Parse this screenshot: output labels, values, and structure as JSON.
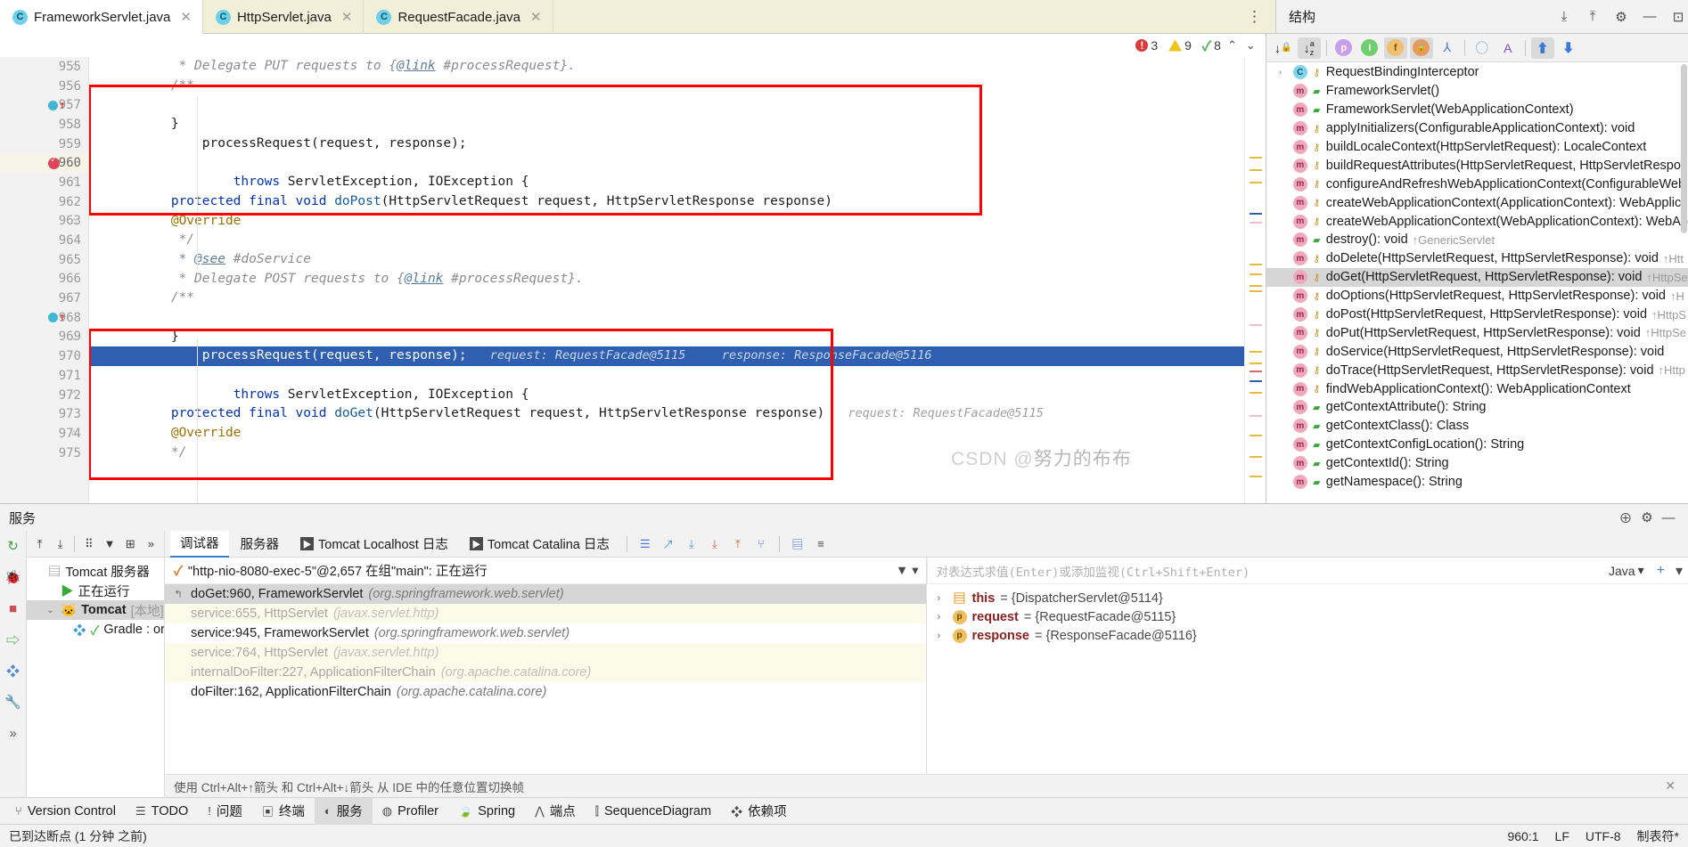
{
  "window": {
    "editor_tabs": [
      {
        "label": "FrameworkServlet.java",
        "icon": "java-class-icon",
        "active": true,
        "close": "✕"
      },
      {
        "label": "HttpServlet.java",
        "icon": "java-class-icon",
        "active": false,
        "close": "✕"
      },
      {
        "label": "RequestFacade.java",
        "icon": "java-class-icon",
        "active": false,
        "close": "✕"
      }
    ],
    "tab_overflow_menu": "⋮"
  },
  "inspections": {
    "errors": "3",
    "warnings": "9",
    "checks": "8",
    "prev": "⌃",
    "next": "⌄"
  },
  "editor": {
    "lines": [
      {
        "num": "955",
        "marker": "",
        "fold": "⌂",
        "html": "        <span class='cmt'>*/</span>"
      },
      {
        "num": "956",
        "marker": "",
        "fold": "",
        "html": "        <span class='ann'>@Override</span>"
      },
      {
        "num": "957",
        "marker": "breakpoint-arrow",
        "fold": "",
        "html": "        <span class='kw'>protected</span> <span class='kw'>final</span> <span class='kw'>void</span> <span class='mth'>doGet</span>(HttpServletRequest request, HttpServletResponse response)   <span class='hint'>request: RequestFacade@5115</span>"
      },
      {
        "num": "958",
        "marker": "",
        "fold": "⌄",
        "html": "                <span class='kw'>throws</span> ServletException, IOException {"
      },
      {
        "num": "959",
        "marker": "",
        "fold": "",
        "html": ""
      },
      {
        "num": "960",
        "marker": "breakpoint-hit",
        "fold": "",
        "highlight": true,
        "html": "            processRequest(request, response);   <span class='hint'>request: RequestFacade@5115     response: ResponseFacade@5116</span>"
      },
      {
        "num": "961",
        "marker": "",
        "fold": "⌃",
        "html": "        }"
      },
      {
        "num": "962",
        "marker": "",
        "fold": "",
        "html": ""
      },
      {
        "num": "963",
        "marker": "",
        "fold": "⌂",
        "html": "        <span class='cmt'>/**</span>"
      },
      {
        "num": "964",
        "marker": "",
        "fold": "",
        "html": "         <span class='cmt'>* Delegate POST requests to {</span><span class='lnk'>@link</span> <span class='cmt'>#processRequest}.</span>"
      },
      {
        "num": "965",
        "marker": "",
        "fold": "",
        "html": "         <span class='cmt-tag'>* </span><span class='lnk'>@see</span> <span class='cmt'>#doService</span>"
      },
      {
        "num": "966",
        "marker": "",
        "fold": "",
        "html": "         <span class='cmt'>*/</span>"
      },
      {
        "num": "967",
        "marker": "",
        "fold": "",
        "html": "        <span class='ann'>@Override</span>"
      },
      {
        "num": "968",
        "marker": "breakpoint-arrow",
        "fold": "",
        "html": "        <span class='kw'>protected</span> <span class='kw'>final</span> <span class='kw'>void</span> <span class='mth'>doPost</span>(HttpServletRequest request, HttpServletResponse response)"
      },
      {
        "num": "969",
        "marker": "",
        "fold": "⌄",
        "html": "                <span class='kw'>throws</span> ServletException, IOException {"
      },
      {
        "num": "970",
        "marker": "",
        "fold": "",
        "html": ""
      },
      {
        "num": "971",
        "marker": "",
        "fold": "",
        "html": "            processRequest(request, response);"
      },
      {
        "num": "972",
        "marker": "",
        "fold": "⌃",
        "html": "        }"
      },
      {
        "num": "973",
        "marker": "",
        "fold": "",
        "html": ""
      },
      {
        "num": "974",
        "marker": "",
        "fold": "⌂",
        "html": "        <span class='cmt'>/**</span>"
      },
      {
        "num": "975",
        "marker": "",
        "fold": "",
        "html": "         <span class='cmt'>* Delegate PUT requests to {</span><span class='lnk'>@link</span> <span class='cmt'>#processRequest}.</span>"
      }
    ],
    "annotation_boxes": [
      {
        "name": "doget-method-highlight",
        "color": "#ff0000"
      },
      {
        "name": "dopost-method-highlight",
        "color": "#ff0000"
      }
    ]
  },
  "structure": {
    "title": "结构",
    "toolbar": [
      {
        "name": "sort-by-visibility-icon",
        "glyph": "↓",
        "active": false
      },
      {
        "name": "sort-alphabetically-icon",
        "glyph": "↓",
        "active": true
      },
      {
        "name": "show-properties-icon",
        "glyph": "p",
        "color": "#c9a0e8"
      },
      {
        "name": "show-inherited-icon",
        "glyph": "I",
        "color": "#6fcf6f"
      },
      {
        "name": "show-fields-icon",
        "glyph": "f",
        "color": "#f0c070"
      },
      {
        "name": "show-non-public-icon",
        "glyph": "🔒",
        "color": "#e89a5a"
      },
      {
        "name": "group-methods-icon",
        "glyph": "Y"
      },
      {
        "name": "expand-all-icon",
        "glyph": "○"
      },
      {
        "name": "autoscroll-icon",
        "glyph": "A"
      },
      {
        "name": "collapse-all-icon",
        "glyph": "⇥"
      },
      {
        "name": "scroll-to-source-icon",
        "glyph": "⇤"
      }
    ],
    "items": [
      {
        "label": "RequestBindingInterceptor",
        "kind": "class",
        "vis": "field",
        "expand": "›",
        "clipped": true
      },
      {
        "label": "FrameworkServlet()",
        "kind": "method",
        "vis": "public"
      },
      {
        "label": "FrameworkServlet(WebApplicationContext)",
        "kind": "method",
        "vis": "public"
      },
      {
        "label": "applyInitializers(ConfigurableApplicationContext): void",
        "kind": "method",
        "vis": "protected"
      },
      {
        "label": "buildLocaleContext(HttpServletRequest): LocaleContext",
        "kind": "method",
        "vis": "protected"
      },
      {
        "label": "buildRequestAttributes(HttpServletRequest, HttpServletRespon",
        "kind": "method",
        "vis": "protected"
      },
      {
        "label": "configureAndRefreshWebApplicationContext(ConfigurableWeb",
        "kind": "method",
        "vis": "protected"
      },
      {
        "label": "createWebApplicationContext(ApplicationContext): WebApplic",
        "kind": "method",
        "vis": "protected"
      },
      {
        "label": "createWebApplicationContext(WebApplicationContext): WebAp",
        "kind": "method",
        "vis": "protected"
      },
      {
        "label": "destroy(): void",
        "sup": "↑GenericServlet",
        "kind": "method",
        "vis": "public"
      },
      {
        "label": "doDelete(HttpServletRequest, HttpServletResponse): void",
        "sup": "↑Htt",
        "kind": "method",
        "vis": "protected"
      },
      {
        "label": "doGet(HttpServletRequest, HttpServletResponse): void",
        "sup": "↑HttpSe",
        "kind": "method",
        "vis": "protected",
        "selected": true
      },
      {
        "label": "doOptions(HttpServletRequest, HttpServletResponse): void",
        "sup": "↑H",
        "kind": "method",
        "vis": "protected"
      },
      {
        "label": "doPost(HttpServletRequest, HttpServletResponse): void",
        "sup": "↑HttpS",
        "kind": "method",
        "vis": "protected"
      },
      {
        "label": "doPut(HttpServletRequest, HttpServletResponse): void",
        "sup": "↑HttpSe",
        "kind": "method",
        "vis": "protected"
      },
      {
        "label": "doService(HttpServletRequest, HttpServletResponse): void",
        "kind": "method",
        "vis": "protected"
      },
      {
        "label": "doTrace(HttpServletRequest, HttpServletResponse): void",
        "sup": "↑Http",
        "kind": "method",
        "vis": "protected"
      },
      {
        "label": "findWebApplicationContext(): WebApplicationContext",
        "kind": "method",
        "vis": "protected"
      },
      {
        "label": "getContextAttribute(): String",
        "kind": "method",
        "vis": "public"
      },
      {
        "label": "getContextClass(): Class<?>",
        "kind": "method",
        "vis": "public"
      },
      {
        "label": "getContextConfigLocation(): String",
        "kind": "method",
        "vis": "public"
      },
      {
        "label": "getContextId(): String",
        "kind": "method",
        "vis": "public"
      },
      {
        "label": "getNamespace(): String",
        "kind": "method",
        "vis": "public",
        "clipped": true
      }
    ]
  },
  "services": {
    "title": "服务",
    "header_buttons": [
      {
        "name": "services-settings-target-icon",
        "glyph": "⊕"
      },
      {
        "name": "services-gear-icon",
        "glyph": "⚙"
      },
      {
        "name": "services-minimize-icon",
        "glyph": "—"
      }
    ],
    "run_controls": [
      {
        "name": "rerun-button",
        "glyph": "↻"
      },
      {
        "name": "debug-button",
        "glyph": "🐞"
      },
      {
        "name": "stop-button",
        "glyph": "■"
      },
      {
        "name": "resume-program-button",
        "glyph": "⇥"
      },
      {
        "name": "step-over-button",
        "glyph": "◆"
      },
      {
        "name": "settings-button",
        "glyph": "🔧"
      },
      {
        "name": "more-button",
        "glyph": "»"
      }
    ],
    "tree_toolbar": [
      {
        "name": "expand-all-icon",
        "glyph": "⤒"
      },
      {
        "name": "collapse-all-icon",
        "glyph": "⤓"
      },
      {
        "name": "group-icon",
        "glyph": "⠿"
      },
      {
        "name": "filter-icon",
        "glyph": "▼"
      },
      {
        "name": "add-icon",
        "glyph": "⊞"
      },
      {
        "name": "more-icon",
        "glyph": "»"
      }
    ],
    "tree": [
      {
        "label": "Tomcat 服务器",
        "indent": 0,
        "icon": "tomcat-group-icon",
        "expand": ""
      },
      {
        "label": "正在运行",
        "indent": 1,
        "icon": "run-icon",
        "expand": ""
      },
      {
        "label": "Tomcat",
        "suffix": "[本地]",
        "indent": 1,
        "icon": "tomcat-icon",
        "expand": "⌄",
        "selected": true,
        "bold": true
      },
      {
        "label": "Gradle : org.s",
        "indent": 2,
        "icon": "gradle-icon",
        "expand": ""
      }
    ],
    "tabs": [
      {
        "label": "调试器",
        "active": true,
        "icon": ""
      },
      {
        "label": "服务器",
        "active": false,
        "icon": ""
      },
      {
        "label": "Tomcat Localhost 日志",
        "active": false,
        "icon": "console-icon"
      },
      {
        "label": "Tomcat Catalina 日志",
        "active": false,
        "icon": "console-icon"
      }
    ],
    "tab_tools": [
      {
        "name": "console-view-icon",
        "glyph": "☰"
      },
      {
        "name": "soft-wrap-icon",
        "glyph": "↵"
      },
      {
        "name": "scroll-down-icon",
        "glyph": "⤓"
      },
      {
        "name": "download-icon",
        "glyph": "⤓"
      },
      {
        "name": "upload-icon",
        "glyph": "⤒"
      },
      {
        "name": "thread-dump-icon",
        "glyph": "⑂"
      },
      {
        "name": "layout-icon",
        "glyph": "▤"
      },
      {
        "name": "settings-icon",
        "glyph": "≡"
      }
    ],
    "thread": {
      "icon": "✓",
      "label": "\"http-nio-8080-exec-5\"@2,657 在组\"main\": 正在运行"
    },
    "frames_tools": [
      {
        "name": "frames-filter-icon",
        "glyph": "▼"
      },
      {
        "name": "frames-dropdown-icon",
        "glyph": "▾"
      }
    ],
    "frames": [
      {
        "method": "doGet:960, FrameworkServlet",
        "pkg": "(org.springframework.web.servlet)",
        "selected": true,
        "dim": false,
        "icon": "↰"
      },
      {
        "method": "service:655, HttpServlet",
        "pkg": "(javax.servlet.http)",
        "selected": false,
        "dim": true,
        "icon": ""
      },
      {
        "method": "service:945, FrameworkServlet",
        "pkg": "(org.springframework.web.servlet)",
        "selected": false,
        "dim": false,
        "icon": ""
      },
      {
        "method": "service:764, HttpServlet",
        "pkg": "(javax.servlet.http)",
        "selected": false,
        "dim": true,
        "icon": ""
      },
      {
        "method": "internalDoFilter:227, ApplicationFilterChain",
        "pkg": "(org.apache.catalina.core)",
        "selected": false,
        "dim": true,
        "icon": ""
      },
      {
        "method": "doFilter:162, ApplicationFilterChain",
        "pkg": "(org.apache.catalina.core)",
        "selected": false,
        "dim": false,
        "icon": "",
        "clipped": true
      }
    ],
    "variables": {
      "eval_placeholder": "对表达式求值(Enter)或添加监视(Ctrl+Shift+Enter)",
      "language": "Java",
      "lang_caret": "▾",
      "add_glyph": "+",
      "settings_glyph": "▾",
      "rows": [
        {
          "expand": "›",
          "icon": "field",
          "name": "this",
          "eq": " = ",
          "value": "{DispatcherServlet@5114}"
        },
        {
          "expand": "›",
          "icon": "param",
          "name": "request",
          "eq": " = ",
          "value": "{RequestFacade@5115}"
        },
        {
          "expand": "›",
          "icon": "param",
          "name": "response",
          "eq": " = ",
          "value": "{ResponseFacade@5116}"
        }
      ]
    },
    "hint": "使用 Ctrl+Alt+↑箭头 和 Ctrl+Alt+↓箭头 从 IDE 中的任意位置切换帧",
    "hint_close": "✕"
  },
  "toolwindows": [
    {
      "label": "Version Control",
      "icon": "branch-icon",
      "active": false
    },
    {
      "label": "TODO",
      "icon": "todo-icon",
      "active": false
    },
    {
      "label": "问题",
      "icon": "problems-icon",
      "active": false
    },
    {
      "label": "终端",
      "icon": "terminal-icon",
      "active": false
    },
    {
      "label": "服务",
      "icon": "services-icon",
      "active": true
    },
    {
      "label": "Profiler",
      "icon": "profiler-icon",
      "active": false
    },
    {
      "label": "Spring",
      "icon": "spring-icon",
      "active": false
    },
    {
      "label": "端点",
      "icon": "endpoints-icon",
      "active": false
    },
    {
      "label": "SequenceDiagram",
      "icon": "sequence-diagram-icon",
      "active": false
    },
    {
      "label": "依赖项",
      "icon": "dependencies-icon",
      "active": false
    }
  ],
  "statusbar": {
    "message": "已到达断点 (1 分钟 之前)",
    "caret": "960:1",
    "line_sep": "LF",
    "encoding": "UTF-8",
    "indent": "制表符*"
  },
  "watermark": {
    "prefix": "CSDN @",
    "name": "努力的布布"
  },
  "colors": {
    "accent": "#2f5fb0",
    "annotation_red": "#ff0000",
    "tab_active_bg": "#ffffff",
    "tab_bg": "#f2efd9",
    "error": "#db3b3b",
    "warning": "#f0c419",
    "ok": "#4caf50"
  }
}
